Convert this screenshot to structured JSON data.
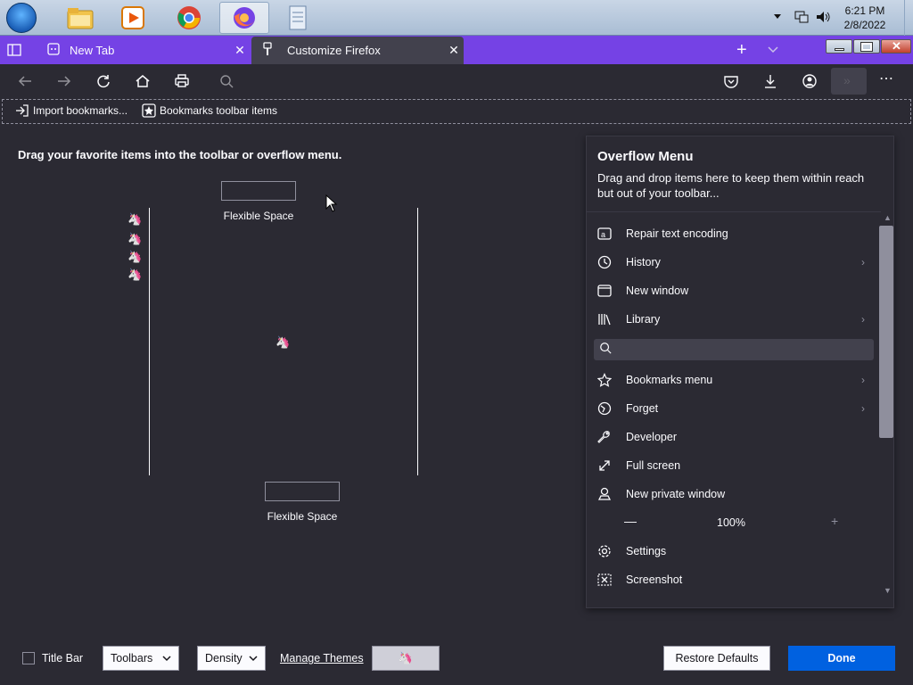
{
  "taskbar": {
    "apps": [
      {
        "name": "file-explorer-icon"
      },
      {
        "name": "media-player-icon"
      },
      {
        "name": "chrome-icon"
      },
      {
        "name": "firefox-icon"
      },
      {
        "name": "notepad-icon"
      }
    ],
    "time": "6:21 PM",
    "date": "2/8/2022"
  },
  "tabs": [
    {
      "label": "New Tab"
    },
    {
      "label": "Customize Firefox"
    }
  ],
  "bookmarks_toolbar": {
    "import_label": "Import bookmarks...",
    "items_label": "Bookmarks toolbar items"
  },
  "customize": {
    "hint": "Drag your favorite items into the toolbar or overflow menu.",
    "flexible_space_top": "Flexible Space",
    "flexible_space_bottom": "Flexible Space"
  },
  "overflow": {
    "title": "Overflow Menu",
    "description": "Drag and drop items here to keep them within reach but out of your toolbar...",
    "items": [
      {
        "label": "Repair text encoding",
        "icon": "text-encoding-icon"
      },
      {
        "label": "History",
        "icon": "history-icon",
        "submenu": true
      },
      {
        "label": "New window",
        "icon": "new-window-icon"
      },
      {
        "label": "Library",
        "icon": "library-icon",
        "submenu": true
      },
      {
        "label": "Bookmarks menu",
        "icon": "bookmark-star-icon",
        "submenu": true
      },
      {
        "label": "Forget",
        "icon": "forget-icon",
        "submenu": true
      },
      {
        "label": "Developer",
        "icon": "wrench-icon"
      },
      {
        "label": "Full screen",
        "icon": "fullscreen-icon"
      },
      {
        "label": "New private window",
        "icon": "private-window-icon"
      },
      {
        "label": "Settings",
        "icon": "gear-icon"
      },
      {
        "label": "Screenshot",
        "icon": "screenshot-icon"
      }
    ],
    "zoom": "100%",
    "zoom_minus": "—",
    "zoom_plus": "+"
  },
  "footer": {
    "title_bar_label": "Title Bar",
    "toolbars_label": "Toolbars",
    "density_label": "Density",
    "manage_themes_label": "Manage Themes",
    "restore_label": "Restore Defaults",
    "done_label": "Done"
  },
  "colors": {
    "tabstrip": "#7542e5",
    "background": "#2b2a33",
    "done_button": "#0061e0"
  }
}
